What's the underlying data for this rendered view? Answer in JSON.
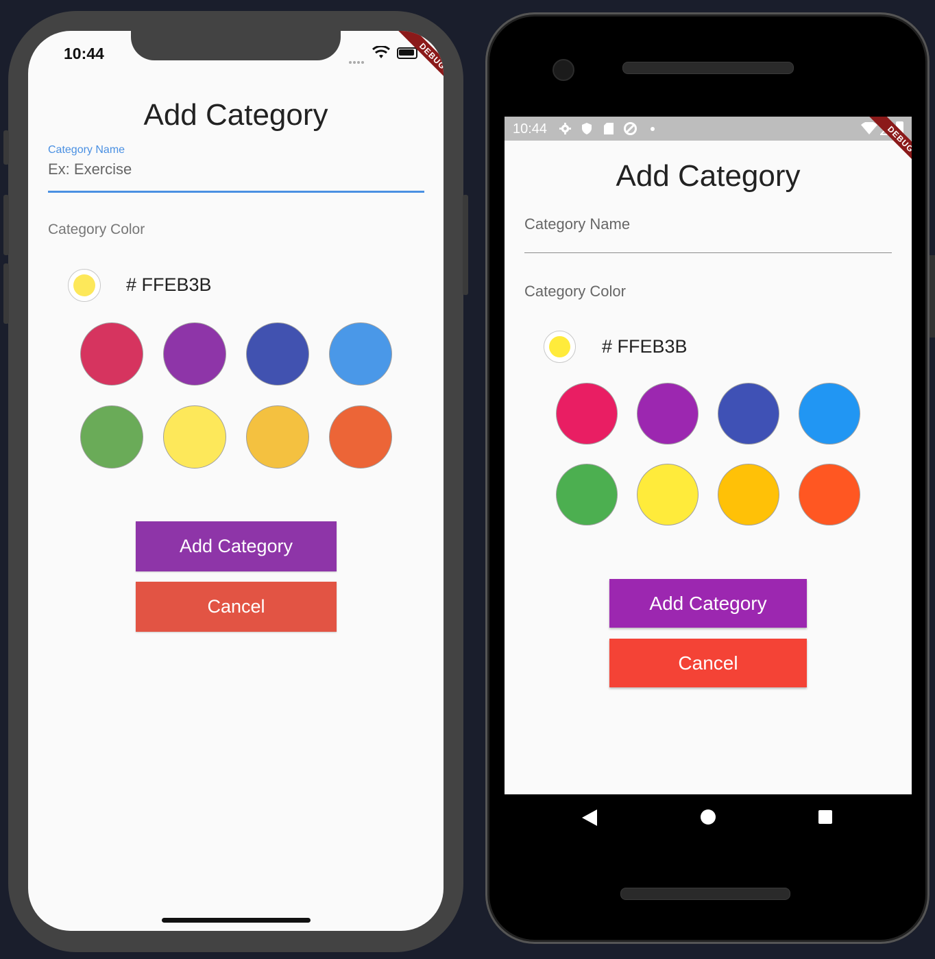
{
  "ios": {
    "time": "10:44",
    "debug_label": "DEBUG",
    "title": "Add Category",
    "name_label": "Category Name",
    "name_placeholder": "Ex: Exercise",
    "color_label": "Category Color",
    "selected_hex": "# FFEB3B",
    "add_button": "Add Category",
    "cancel_button": "Cancel",
    "swatch_colors": [
      "#d6345f",
      "#8e35a8",
      "#4152b0",
      "#4a98e8",
      "#6aab58",
      "#fde85a",
      "#f4c140",
      "#ec6537"
    ],
    "selected_color": "#fde85a",
    "add_button_color": "#8e35a8",
    "cancel_button_color": "#e25444"
  },
  "android": {
    "time": "10:44",
    "debug_label": "DEBUG",
    "title": "Add Category",
    "name_label": "Category Name",
    "color_label": "Category Color",
    "selected_hex": "# FFEB3B",
    "add_button": "Add Category",
    "cancel_button": "Cancel",
    "swatch_colors": [
      "#e91e63",
      "#9c27b0",
      "#3f51b5",
      "#2196f3",
      "#4caf50",
      "#ffeb3b",
      "#ffc107",
      "#ff5722"
    ],
    "selected_color": "#ffeb3b",
    "add_button_color": "#9c27b0",
    "cancel_button_color": "#f44336"
  }
}
